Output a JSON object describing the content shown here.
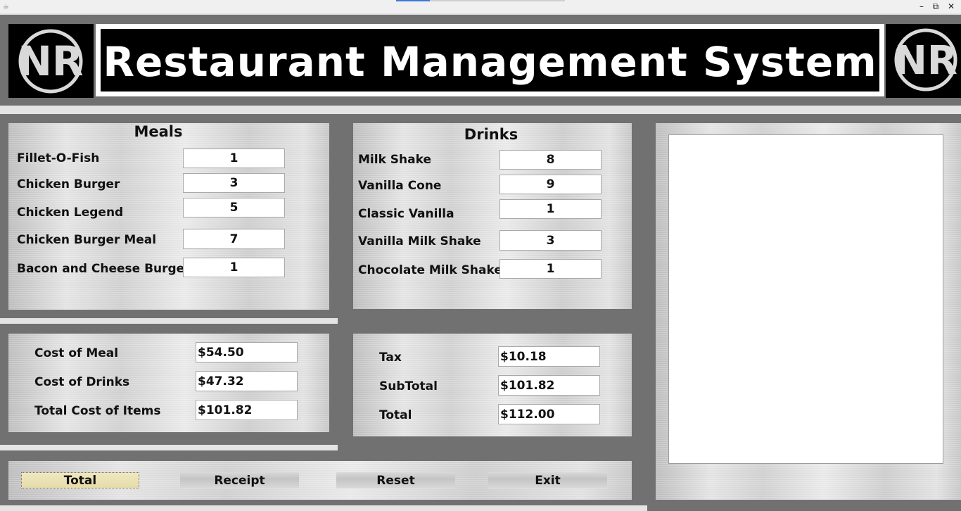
{
  "window": {
    "app_icon": "coffee-cup-icon",
    "controls": {
      "minimize": "–",
      "restore": "⧉",
      "close": "✕"
    }
  },
  "header": {
    "title": "Restaurant Management System",
    "logo_text": "NR"
  },
  "meals": {
    "title": "Meals",
    "items": [
      {
        "label": "Fillet-O-Fish",
        "qty": "1"
      },
      {
        "label": "Chicken Burger",
        "qty": "3"
      },
      {
        "label": "Chicken Legend",
        "qty": "5"
      },
      {
        "label": "Chicken Burger Meal",
        "qty": "7"
      },
      {
        "label": "Bacon and Cheese Burger",
        "qty": "1"
      }
    ]
  },
  "drinks": {
    "title": "Drinks",
    "items": [
      {
        "label": "Milk Shake",
        "qty": "8"
      },
      {
        "label": "Vanilla Cone",
        "qty": "9"
      },
      {
        "label": "Classic Vanilla",
        "qty": "1"
      },
      {
        "label": "Vanilla Milk Shake",
        "qty": "3"
      },
      {
        "label": "Chocolate Milk Shake",
        "qty": "1"
      }
    ]
  },
  "costs": {
    "items": [
      {
        "label": "Cost of Meal",
        "value": "$54.50"
      },
      {
        "label": "Cost of Drinks",
        "value": "$47.32"
      },
      {
        "label": "Total Cost of Items",
        "value": "$101.82"
      }
    ]
  },
  "totals": {
    "items": [
      {
        "label": "Tax",
        "value": "$10.18"
      },
      {
        "label": "SubTotal",
        "value": "$101.82"
      },
      {
        "label": "Total",
        "value": "$112.00"
      }
    ]
  },
  "buttons": {
    "total": "Total",
    "receipt": "Receipt",
    "reset": "Reset",
    "exit": "Exit"
  },
  "receipt": {
    "text": ""
  },
  "colors": {
    "frame": "#717171",
    "banner_bg": "#000000",
    "banner_text": "#ffffff",
    "active_button": "#e9e0b0"
  }
}
